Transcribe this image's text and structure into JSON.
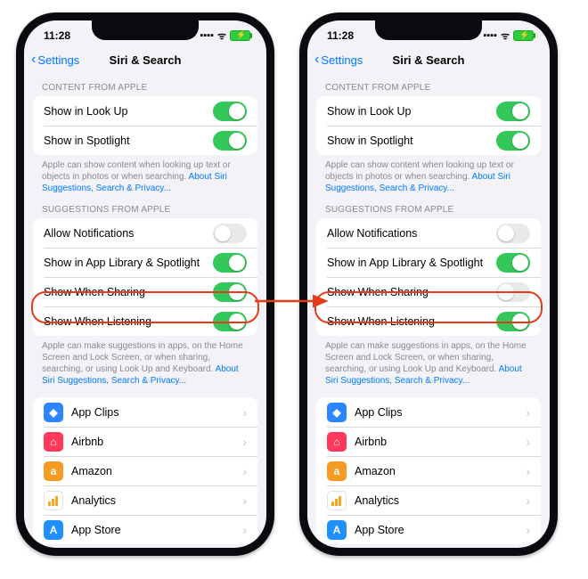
{
  "status_time": "11:28",
  "nav": {
    "back_label": "Settings",
    "title": "Siri & Search"
  },
  "sections": {
    "content_header": "CONTENT FROM APPLE",
    "suggestions_header": "SUGGESTIONS FROM APPLE"
  },
  "notes": {
    "content_text": "Apple can show content when looking up text or objects in photos or when searching. ",
    "content_link": "About Siri Suggestions, Search & Privacy...",
    "suggestions_text": "Apple can make suggestions in apps, on the Home Screen and Lock Screen, or when sharing, searching, or using Look Up and Keyboard. ",
    "suggestions_link": "About Siri Suggestions, Search & Privacy..."
  },
  "content_toggles": [
    {
      "label": "Show in Look Up",
      "on": true
    },
    {
      "label": "Show in Spotlight",
      "on": true
    }
  ],
  "suggestion_toggles_left": [
    {
      "label": "Allow Notifications",
      "on": false
    },
    {
      "label": "Show in App Library & Spotlight",
      "on": true
    },
    {
      "label": "Show When Sharing",
      "on": true
    },
    {
      "label": "Show When Listening",
      "on": true
    }
  ],
  "suggestion_toggles_right": [
    {
      "label": "Allow Notifications",
      "on": false
    },
    {
      "label": "Show in App Library & Spotlight",
      "on": true
    },
    {
      "label": "Show When Sharing",
      "on": false
    },
    {
      "label": "Show When Listening",
      "on": true
    }
  ],
  "apps": [
    {
      "label": "App Clips",
      "glyph": "◆",
      "color": "#2b86ff"
    },
    {
      "label": "Airbnb",
      "glyph": "⌂",
      "color": "#ff385c"
    },
    {
      "label": "Amazon",
      "glyph": "a",
      "color": "#f59b23"
    },
    {
      "label": "Analytics",
      "glyph": "▁",
      "color": "#ffffff"
    },
    {
      "label": "App Store",
      "glyph": "A",
      "color": "#1e90ff"
    }
  ]
}
